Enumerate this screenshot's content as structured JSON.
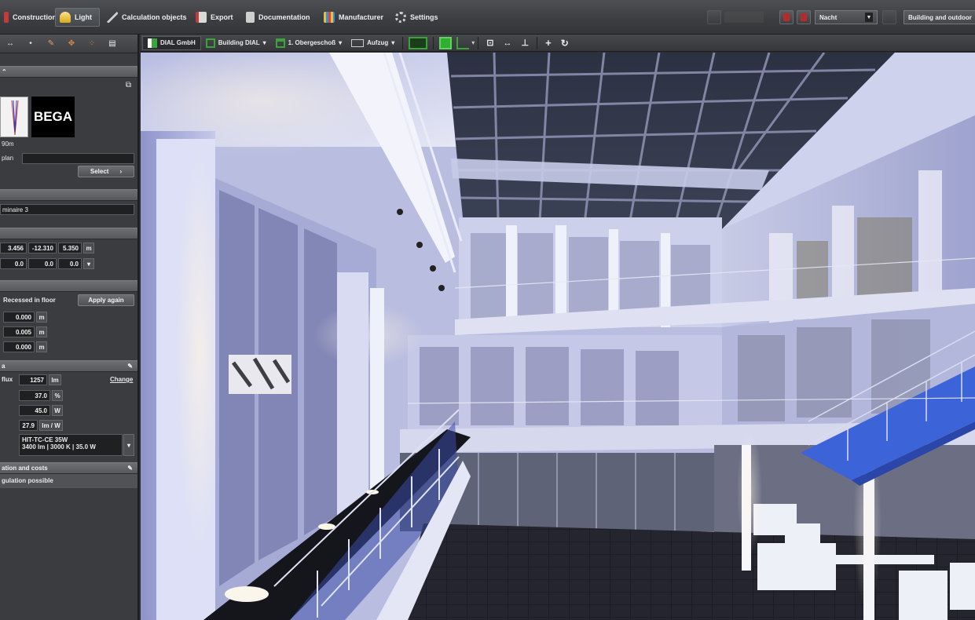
{
  "menubar": {
    "items": [
      {
        "label": "Construction"
      },
      {
        "label": "Light"
      },
      {
        "label": "Calculation objects"
      },
      {
        "label": "Export"
      },
      {
        "label": "Documentation"
      },
      {
        "label": "Manufacturer"
      },
      {
        "label": "Settings"
      }
    ],
    "active_index": 1,
    "scene_select": "Nacht",
    "mode_select": "Building and outdoor"
  },
  "leftpanel": {
    "manufacturer_logo": "BEGA",
    "distance_label": "90m",
    "plan_label": "plan",
    "select_button": "Select",
    "luminaire_name": "minaire 3",
    "position": {
      "x": "3.456",
      "y": "-12.310",
      "z": "5.350",
      "unit": "m"
    },
    "rotation": {
      "a": "0.0",
      "b": "0.0",
      "c": "0.0"
    },
    "mounting": "Recessed in floor",
    "apply_again": "Apply again",
    "offsets": [
      {
        "value": "0.000",
        "unit": "m"
      },
      {
        "value": "0.005",
        "unit": "m"
      },
      {
        "value": "0.000",
        "unit": "m"
      }
    ],
    "section_light": "a",
    "flux_label": "flux",
    "change_label": "Change",
    "lumen": {
      "value": "1257",
      "unit": "lm"
    },
    "efficiency": {
      "value": "37.0",
      "unit": "%"
    },
    "power": {
      "value": "45.0",
      "unit": "W"
    },
    "efficacy": {
      "value": "27.9",
      "unit": "lm / W"
    },
    "lamp_line1": "HIT-TC-CE  35W",
    "lamp_line2": "3400 lm  |  3000 K  |  35.0 W",
    "section_maintenance": "ation and costs",
    "regulation": "gulation possible"
  },
  "viewport_toolbar": {
    "items": [
      {
        "label": "DIAL GmbH"
      },
      {
        "label": "Building DIAL"
      },
      {
        "label": "1. Obergeschoß"
      },
      {
        "label": "Aufzug"
      }
    ]
  },
  "colors": {
    "menubar": "#3b3d40",
    "panel": "#3a3c3f",
    "accent_green": "#2fae2f",
    "render_wall": "#c9cde8",
    "render_floor": "#1a1b22"
  }
}
